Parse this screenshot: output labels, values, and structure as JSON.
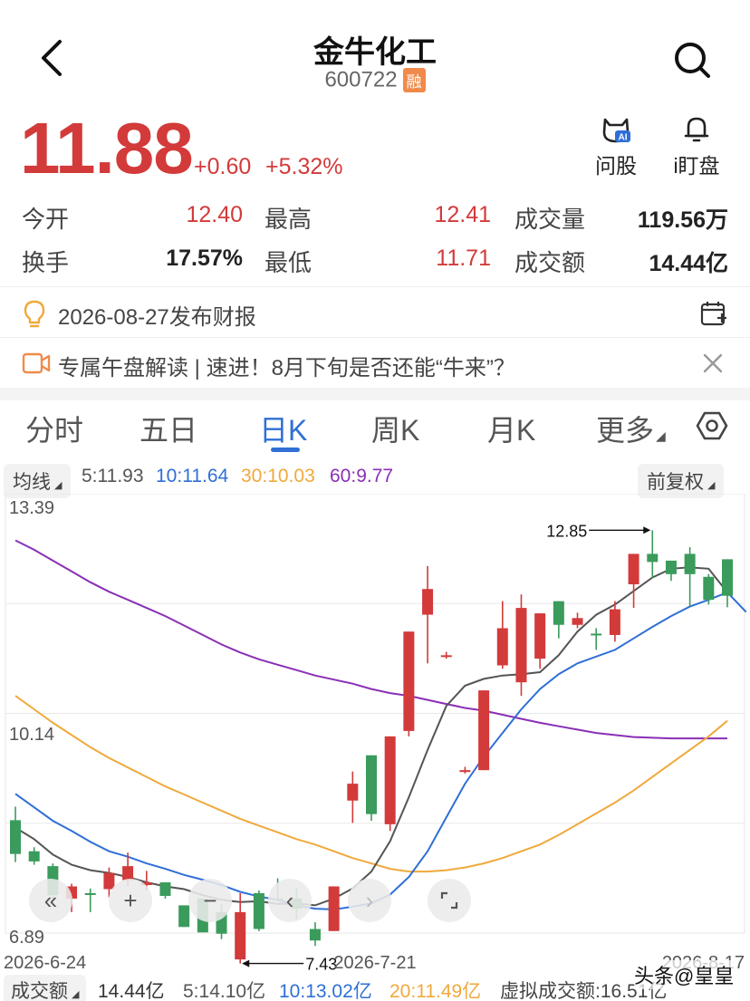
{
  "header": {
    "title": "金牛化工",
    "code": "600722",
    "badge": "融"
  },
  "quote": {
    "price": "11.88",
    "change": "+0.60",
    "change_pct": "+5.32%"
  },
  "tools": [
    {
      "label": "问股",
      "icon": "ai-cat-icon"
    },
    {
      "label": "i盯盘",
      "icon": "bell-icon"
    }
  ],
  "stats": {
    "open_label": "今开",
    "open": "12.40",
    "high_label": "最高",
    "high": "12.41",
    "volume_label": "成交量",
    "volume": "119.56万",
    "turnover_label": "换手",
    "turnover": "17.57%",
    "low_label": "最低",
    "low": "11.71",
    "amount_label": "成交额",
    "amount": "14.44亿"
  },
  "notices": {
    "report": "2026-08-27发布财报",
    "live": "专属午盘解读 | 速进！8月下旬是否还能“牛来”？"
  },
  "tabs": [
    "分时",
    "五日",
    "日K",
    "周K",
    "月K",
    "更多"
  ],
  "active_tab": "日K",
  "ma": {
    "selector": "均线",
    "ma5": "5:11.93",
    "ma10": "10:11.64",
    "ma30": "30:10.03",
    "ma60": "60:9.77",
    "adjust": "前复权"
  },
  "colors": {
    "up": "#d33a3a",
    "down": "#3a9b5c",
    "ma5": "#555555",
    "ma10": "#2f6fd6",
    "ma30": "#f0a93c",
    "ma60": "#8a2fb6",
    "accent": "#2f6fd6"
  },
  "chart_data": {
    "type": "candlestick",
    "y_max_label": "13.39",
    "y_mid_label": "10.14",
    "y_min_label": "6.89",
    "ylim": [
      6.89,
      13.39
    ],
    "x_labels": [
      "2026-6-24",
      "2026-7-21",
      "2026-8-17"
    ],
    "high_annotation": "12.85",
    "low_annotation": "7.43",
    "candles": [
      {
        "o": 8.56,
        "c": 8.06,
        "h": 8.76,
        "l": 7.94
      },
      {
        "o": 8.1,
        "c": 7.95,
        "h": 8.16,
        "l": 7.9
      },
      {
        "o": 7.88,
        "c": 7.45,
        "h": 7.92,
        "l": 7.4
      },
      {
        "o": 7.4,
        "c": 7.58,
        "h": 7.62,
        "l": 7.2
      },
      {
        "o": 7.48,
        "c": 7.46,
        "h": 7.55,
        "l": 7.2
      },
      {
        "o": 7.54,
        "c": 7.78,
        "h": 7.86,
        "l": 7.42
      },
      {
        "o": 7.67,
        "c": 7.88,
        "h": 8.08,
        "l": 7.59
      },
      {
        "o": 7.6,
        "c": 7.64,
        "h": 7.81,
        "l": 7.52
      },
      {
        "o": 7.64,
        "c": 7.44,
        "h": 7.64,
        "l": 7.4
      },
      {
        "o": 7.3,
        "c": 6.98,
        "h": 7.3,
        "l": 6.98
      },
      {
        "o": 7.4,
        "c": 6.9,
        "h": 7.4,
        "l": 6.9
      },
      {
        "o": 7.2,
        "c": 6.88,
        "h": 7.32,
        "l": 6.8
      },
      {
        "o": 6.5,
        "c": 7.2,
        "h": 7.48,
        "l": 6.44
      },
      {
        "o": 7.48,
        "c": 6.95,
        "h": 7.52,
        "l": 6.92
      },
      {
        "o": 7.4,
        "c": 7.38,
        "h": 7.7,
        "l": 7.36
      },
      {
        "o": 7.4,
        "c": 7.25,
        "h": 7.55,
        "l": 7.1
      },
      {
        "o": 6.95,
        "c": 6.78,
        "h": 7.05,
        "l": 6.7
      },
      {
        "o": 6.92,
        "c": 7.58,
        "h": 7.58,
        "l": 6.92
      },
      {
        "o": 8.85,
        "c": 9.1,
        "h": 9.28,
        "l": 8.52
      },
      {
        "o": 9.52,
        "c": 8.65,
        "h": 9.52,
        "l": 8.55
      },
      {
        "o": 8.5,
        "c": 9.8,
        "h": 9.8,
        "l": 8.4
      },
      {
        "o": 9.88,
        "c": 11.35,
        "h": 11.35,
        "l": 9.8
      },
      {
        "o": 11.6,
        "c": 11.98,
        "h": 12.32,
        "l": 10.88
      },
      {
        "o": 10.99,
        "c": 11.0,
        "h": 11.05,
        "l": 10.95
      },
      {
        "o": 9.3,
        "c": 9.3,
        "h": 9.35,
        "l": 9.25
      },
      {
        "o": 9.3,
        "c": 10.48,
        "h": 10.48,
        "l": 9.3
      },
      {
        "o": 10.85,
        "c": 11.4,
        "h": 11.8,
        "l": 10.8
      },
      {
        "o": 10.6,
        "c": 11.7,
        "h": 11.9,
        "l": 10.4
      },
      {
        "o": 10.95,
        "c": 11.62,
        "h": 11.62,
        "l": 10.8
      },
      {
        "o": 11.8,
        "c": 11.45,
        "h": 11.8,
        "l": 11.25
      },
      {
        "o": 11.45,
        "c": 11.55,
        "h": 11.63,
        "l": 11.4
      },
      {
        "o": 11.32,
        "c": 11.3,
        "h": 11.4,
        "l": 11.08
      },
      {
        "o": 11.3,
        "c": 11.68,
        "h": 11.8,
        "l": 11.2
      },
      {
        "o": 12.05,
        "c": 12.5,
        "h": 12.5,
        "l": 11.7
      },
      {
        "o": 12.5,
        "c": 12.38,
        "h": 12.85,
        "l": 12.14
      },
      {
        "o": 12.4,
        "c": 12.2,
        "h": 12.38,
        "l": 12.1
      },
      {
        "o": 12.5,
        "c": 12.2,
        "h": 12.6,
        "l": 11.72
      },
      {
        "o": 12.16,
        "c": 11.82,
        "h": 12.2,
        "l": 11.75
      },
      {
        "o": 12.42,
        "c": 11.88,
        "h": 12.42,
        "l": 11.71
      }
    ],
    "ma5_values": [
      8.45,
      8.28,
      8.05,
      7.9,
      7.82,
      7.78,
      7.72,
      7.64,
      7.58,
      7.54,
      7.45,
      7.38,
      7.35,
      7.36,
      7.32,
      7.33,
      7.3,
      7.4,
      7.55,
      7.8,
      8.25,
      8.9,
      9.6,
      10.25,
      10.55,
      10.65,
      10.7,
      10.72,
      10.75,
      11.0,
      11.35,
      11.6,
      11.75,
      11.95,
      12.15,
      12.28,
      12.3,
      12.28,
      11.93
    ],
    "ma10_values": [
      8.95,
      8.75,
      8.55,
      8.4,
      8.24,
      8.1,
      8.02,
      7.92,
      7.84,
      7.75,
      7.68,
      7.6,
      7.5,
      7.43,
      7.38,
      7.3,
      7.25,
      7.24,
      7.28,
      7.33,
      7.46,
      7.72,
      8.1,
      8.6,
      9.1,
      9.5,
      9.85,
      10.2,
      10.5,
      10.72,
      10.88,
      10.98,
      11.08,
      11.25,
      11.42,
      11.58,
      11.72,
      11.82,
      11.93,
      11.64
    ],
    "ma30_values": [
      10.4,
      10.2,
      10.0,
      9.82,
      9.64,
      9.48,
      9.34,
      9.2,
      9.06,
      8.94,
      8.82,
      8.7,
      8.58,
      8.48,
      8.38,
      8.28,
      8.2,
      8.1,
      8.0,
      7.92,
      7.84,
      7.8,
      7.8,
      7.82,
      7.86,
      7.92,
      8.0,
      8.1,
      8.2,
      8.34,
      8.5,
      8.66,
      8.82,
      9.0,
      9.2,
      9.4,
      9.6,
      9.8,
      10.03
    ],
    "ma60_values": [
      12.7,
      12.56,
      12.4,
      12.24,
      12.08,
      11.94,
      11.82,
      11.7,
      11.58,
      11.44,
      11.3,
      11.16,
      11.04,
      10.94,
      10.86,
      10.78,
      10.7,
      10.64,
      10.58,
      10.5,
      10.44,
      10.4,
      10.34,
      10.28,
      10.22,
      10.18,
      10.12,
      10.06,
      10.0,
      9.95,
      9.9,
      9.85,
      9.82,
      9.79,
      9.78,
      9.77,
      9.77,
      9.77,
      9.77
    ]
  },
  "bottom": {
    "selector": "成交额",
    "total": "14.44亿",
    "m5": "5:14.10亿",
    "m10": "10:13.02亿",
    "m20": "20:11.49亿",
    "virtual": "虚拟成交额:16.51亿",
    "watermark": "头条@皇皇"
  }
}
